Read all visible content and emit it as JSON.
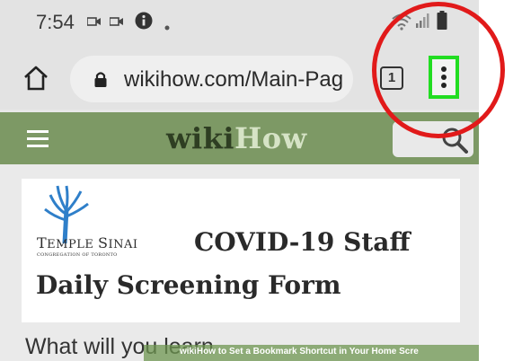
{
  "status_bar": {
    "time": "7:54"
  },
  "browser": {
    "url": "wikihow.com/Main-Pag",
    "tab_count": "1"
  },
  "site": {
    "logo_wiki": "wiki",
    "logo_how": "How"
  },
  "article_image": {
    "org_name_first": "T",
    "org_name_rest": "EMPLE ",
    "org_name_first2": "S",
    "org_name_rest2": "INAI",
    "org_subtitle": "CONGREGATION OF TORONTO",
    "form_title_line1": "COVID-19 Staff",
    "form_title_line2": "Daily Screening Form"
  },
  "body_text": "What will you learn",
  "watermark": "wikiHow to Set a Bookmark Shortcut in Your Home Scre",
  "colors": {
    "wikihow_green": "#7d9965",
    "highlight_green": "#22dd22",
    "annotation_red": "#e11a1a"
  }
}
